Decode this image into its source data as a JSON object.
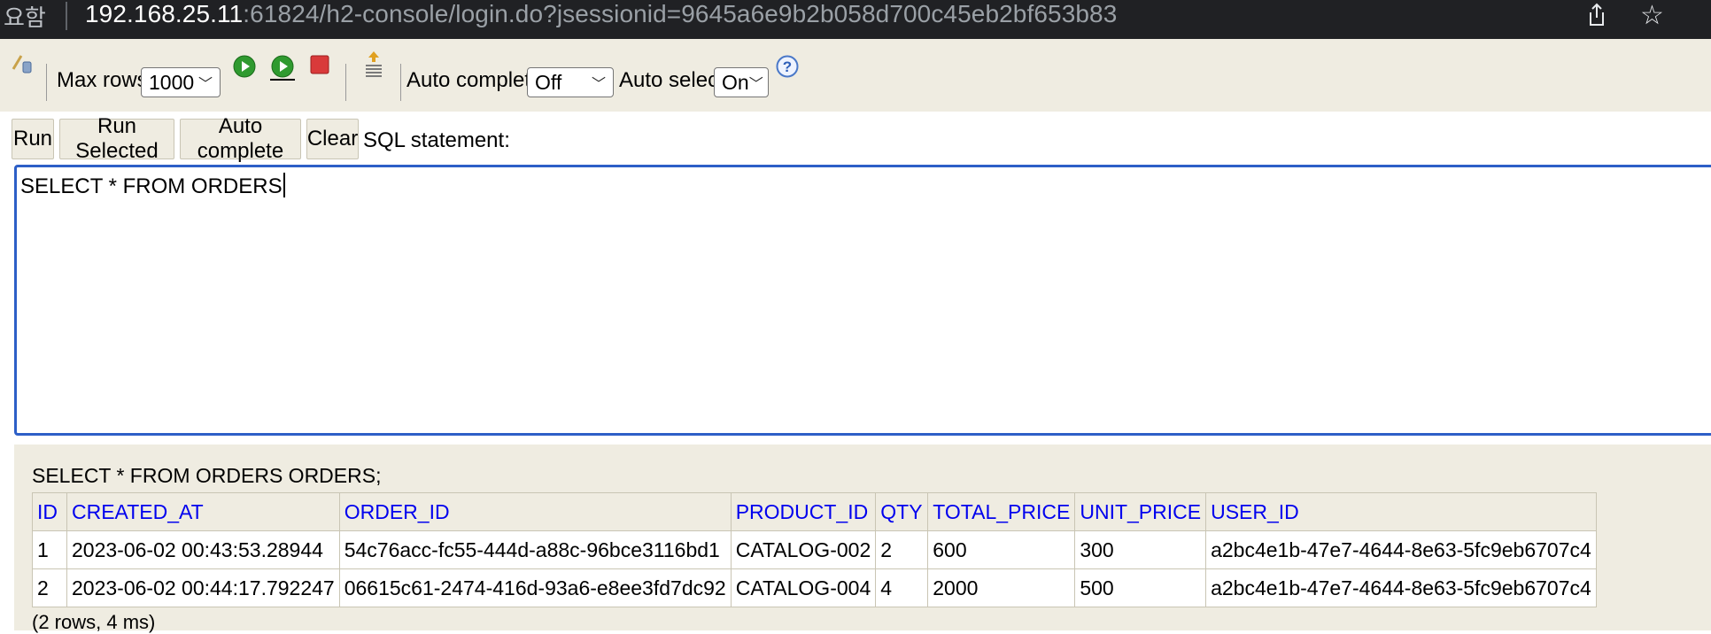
{
  "browser": {
    "tab_fragment": "요함",
    "url_host": "192.168.25.11",
    "url_rest": ":61824/h2-console/login.do?jsessionid=9645a6e9b2b058d700c45eb2bf653b83",
    "icons": [
      "share-icon",
      "bookmark-star-icon"
    ]
  },
  "toolbar": {
    "max_rows_label": "Max rows:",
    "max_rows_value": "1000",
    "auto_complete_label": "Auto complete",
    "auto_complete_value": "Off",
    "auto_select_label": "Auto select",
    "auto_select_value": "On",
    "icons": [
      "connect-icon",
      "run-icon",
      "run-selected-icon",
      "stop-icon",
      "history-icon",
      "help-icon"
    ]
  },
  "buttons": {
    "run": "Run",
    "run_selected": "Run Selected",
    "auto_complete": "Auto complete",
    "clear": "Clear",
    "sql_statement_label": "SQL statement:"
  },
  "editor": {
    "sql": "SELECT * FROM ORDERS"
  },
  "result": {
    "echo": "SELECT * FROM ORDERS ORDERS;",
    "columns": [
      "ID",
      "CREATED_AT",
      "ORDER_ID",
      "PRODUCT_ID",
      "QTY",
      "TOTAL_PRICE",
      "UNIT_PRICE",
      "USER_ID"
    ],
    "rows": [
      [
        "1",
        "2023-06-02 00:43:53.28944",
        "54c76acc-fc55-444d-a88c-96bce3116bd1",
        "CATALOG-002",
        "2",
        "600",
        "300",
        "a2bc4e1b-47e7-4644-8e63-5fc9eb6707c4"
      ],
      [
        "2",
        "2023-06-02 00:44:17.792247",
        "06615c61-2474-416d-93a6-e8ee3fd7dc92",
        "CATALOG-004",
        "4",
        "2000",
        "500",
        "a2bc4e1b-47e7-4644-8e63-5fc9eb6707c4"
      ]
    ],
    "summary": "(2 rows, 4 ms)"
  },
  "colors": {
    "toolbar_bg": "#efece1",
    "header_link": "#0000ee",
    "editor_border": "#2d5fc7",
    "addressbar_bg": "#202124"
  }
}
